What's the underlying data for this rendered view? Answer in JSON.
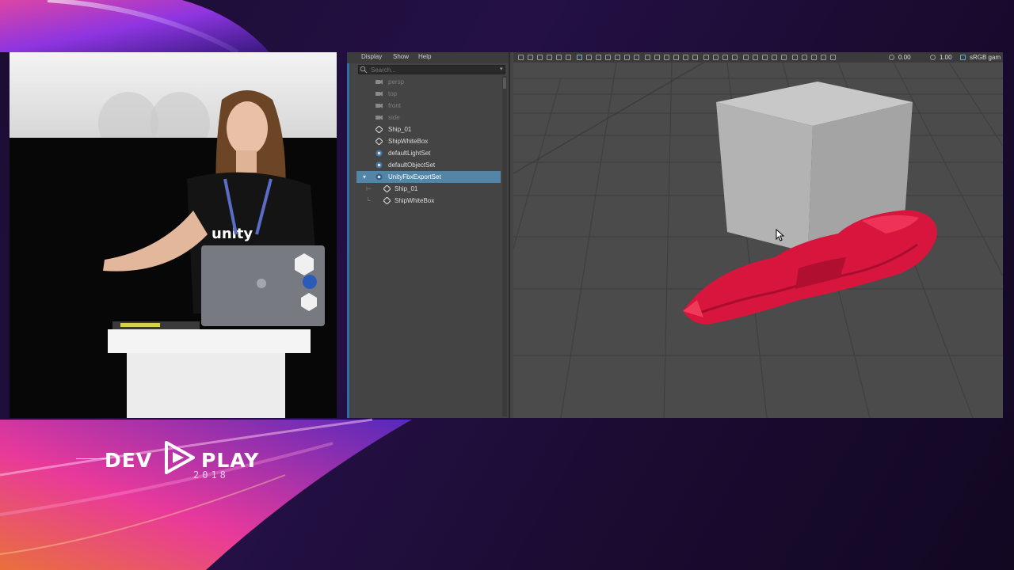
{
  "event": {
    "logo_left": "DEV",
    "logo_right": "PLAY",
    "logo_year": "2018"
  },
  "outliner": {
    "menu": [
      "Display",
      "Show",
      "Help"
    ],
    "search_placeholder": "Search...",
    "items": [
      {
        "label": "persp",
        "icon": "camera-icon",
        "dim": true,
        "indent": 0
      },
      {
        "label": "top",
        "icon": "camera-icon",
        "dim": true,
        "indent": 0
      },
      {
        "label": "front",
        "icon": "camera-icon",
        "dim": true,
        "indent": 0
      },
      {
        "label": "side",
        "icon": "camera-icon",
        "dim": true,
        "indent": 0
      },
      {
        "label": "Ship_01",
        "icon": "transform-icon",
        "dim": false,
        "indent": 0
      },
      {
        "label": "ShipWhiteBox",
        "icon": "transform-icon",
        "dim": false,
        "indent": 0
      },
      {
        "label": "defaultLightSet",
        "icon": "set-icon",
        "dim": false,
        "indent": 0
      },
      {
        "label": "defaultObjectSet",
        "icon": "set-icon",
        "dim": false,
        "indent": 0
      },
      {
        "label": "UnityFbxExportSet",
        "icon": "set-icon",
        "dim": false,
        "indent": 0,
        "selected": true
      },
      {
        "label": "Ship_01",
        "icon": "transform-icon",
        "dim": false,
        "indent": 1
      },
      {
        "label": "ShipWhiteBox",
        "icon": "transform-icon",
        "dim": false,
        "indent": 1
      }
    ]
  },
  "viewport": {
    "exposure": "0.00",
    "gamma": "1.00",
    "color_space": "sRGB gam"
  },
  "colors": {
    "selection": "#5285a6",
    "ship": "#e0183f",
    "box": "#b9b9b9",
    "grid_floor": "#4d4d4d"
  }
}
